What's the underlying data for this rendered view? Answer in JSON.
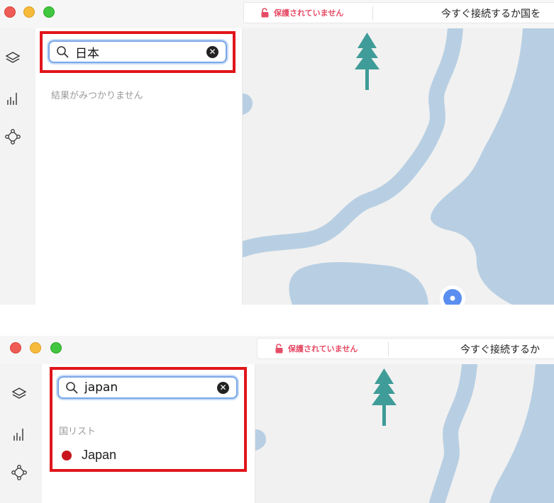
{
  "status": {
    "unprotected_label": "保護されていません",
    "connect_prompt_top": "今すぐ接続するか国を",
    "connect_prompt_bottom": "今すぐ接続するか"
  },
  "colors": {
    "highlight": "#e0161b",
    "unprotected": "#e64b65",
    "water": "#b8cfe3",
    "tree": "#3f9c98",
    "country_dot": "#c8151e"
  },
  "icons": {
    "lock": "unlocked-padlock",
    "layers": "layers-icon",
    "stats": "bar-chart-icon",
    "nodes": "network-nodes-icon",
    "search": "magnifier-icon",
    "clear": "clear-x-icon",
    "tree": "tree-icon",
    "location": "location-pin-icon"
  },
  "top_state": {
    "search_value": "日本",
    "empty_message": "結果がみつかりません"
  },
  "bottom_state": {
    "search_value": "japan",
    "section_header": "国リスト",
    "country": "Japan"
  },
  "clear_glyph": "✕"
}
